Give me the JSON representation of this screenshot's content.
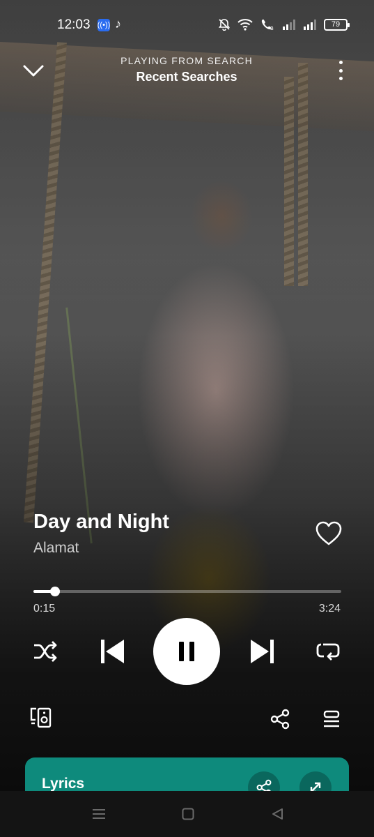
{
  "status_bar": {
    "time": "12:03",
    "battery": "79",
    "icons": [
      "broadcast-app-icon",
      "tiktok-icon",
      "mute-bell-icon",
      "wifi-icon",
      "volte-call-icon",
      "signal-icon",
      "signal-icon",
      "battery-icon"
    ]
  },
  "header": {
    "context_label": "PLAYING FROM SEARCH",
    "source_name": "Recent Searches",
    "collapse_icon": "chevron-down-icon",
    "more_icon": "more-vertical-icon"
  },
  "track": {
    "title": "Day and Night",
    "artist": "Alamat",
    "liked": false
  },
  "playback": {
    "elapsed": "0:15",
    "total": "3:24",
    "progress_fraction": 0.07,
    "state": "playing"
  },
  "controls": [
    "shuffle-icon",
    "previous-icon",
    "pause-icon",
    "next-icon",
    "repeat-icon"
  ],
  "secondary_controls": [
    "connect-devices-icon",
    "share-icon",
    "queue-icon"
  ],
  "lyrics_card": {
    "label": "Lyrics",
    "color": "#0e8a7c"
  },
  "system_nav": [
    "recent-apps-icon",
    "home-icon",
    "back-icon"
  ]
}
